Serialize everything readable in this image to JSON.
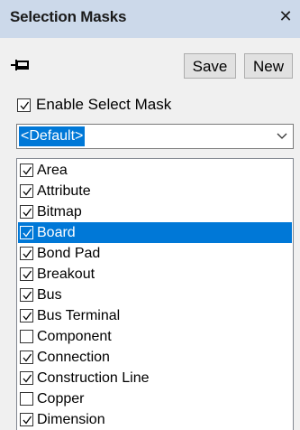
{
  "panel": {
    "title": "Selection Masks",
    "close_icon": "close-icon",
    "pin_icon": "pin-icon"
  },
  "toolbar": {
    "save_label": "Save",
    "new_label": "New"
  },
  "enable": {
    "label": "Enable Select Mask",
    "checked": true
  },
  "combo": {
    "value": "<Default>"
  },
  "colors": {
    "titlebar_bg": "#ccd9ea",
    "selection": "#0078d7",
    "panel_bg": "#f0f0f0"
  },
  "list": {
    "items": [
      {
        "label": "Area",
        "checked": true,
        "selected": false
      },
      {
        "label": "Attribute",
        "checked": true,
        "selected": false
      },
      {
        "label": "Bitmap",
        "checked": true,
        "selected": false
      },
      {
        "label": "Board",
        "checked": true,
        "selected": true
      },
      {
        "label": "Bond Pad",
        "checked": true,
        "selected": false
      },
      {
        "label": "Breakout",
        "checked": true,
        "selected": false
      },
      {
        "label": "Bus",
        "checked": true,
        "selected": false
      },
      {
        "label": "Bus Terminal",
        "checked": true,
        "selected": false
      },
      {
        "label": "Component",
        "checked": false,
        "selected": false
      },
      {
        "label": "Connection",
        "checked": true,
        "selected": false
      },
      {
        "label": "Construction Line",
        "checked": true,
        "selected": false
      },
      {
        "label": "Copper",
        "checked": false,
        "selected": false
      },
      {
        "label": "Dimension",
        "checked": true,
        "selected": false
      }
    ]
  }
}
